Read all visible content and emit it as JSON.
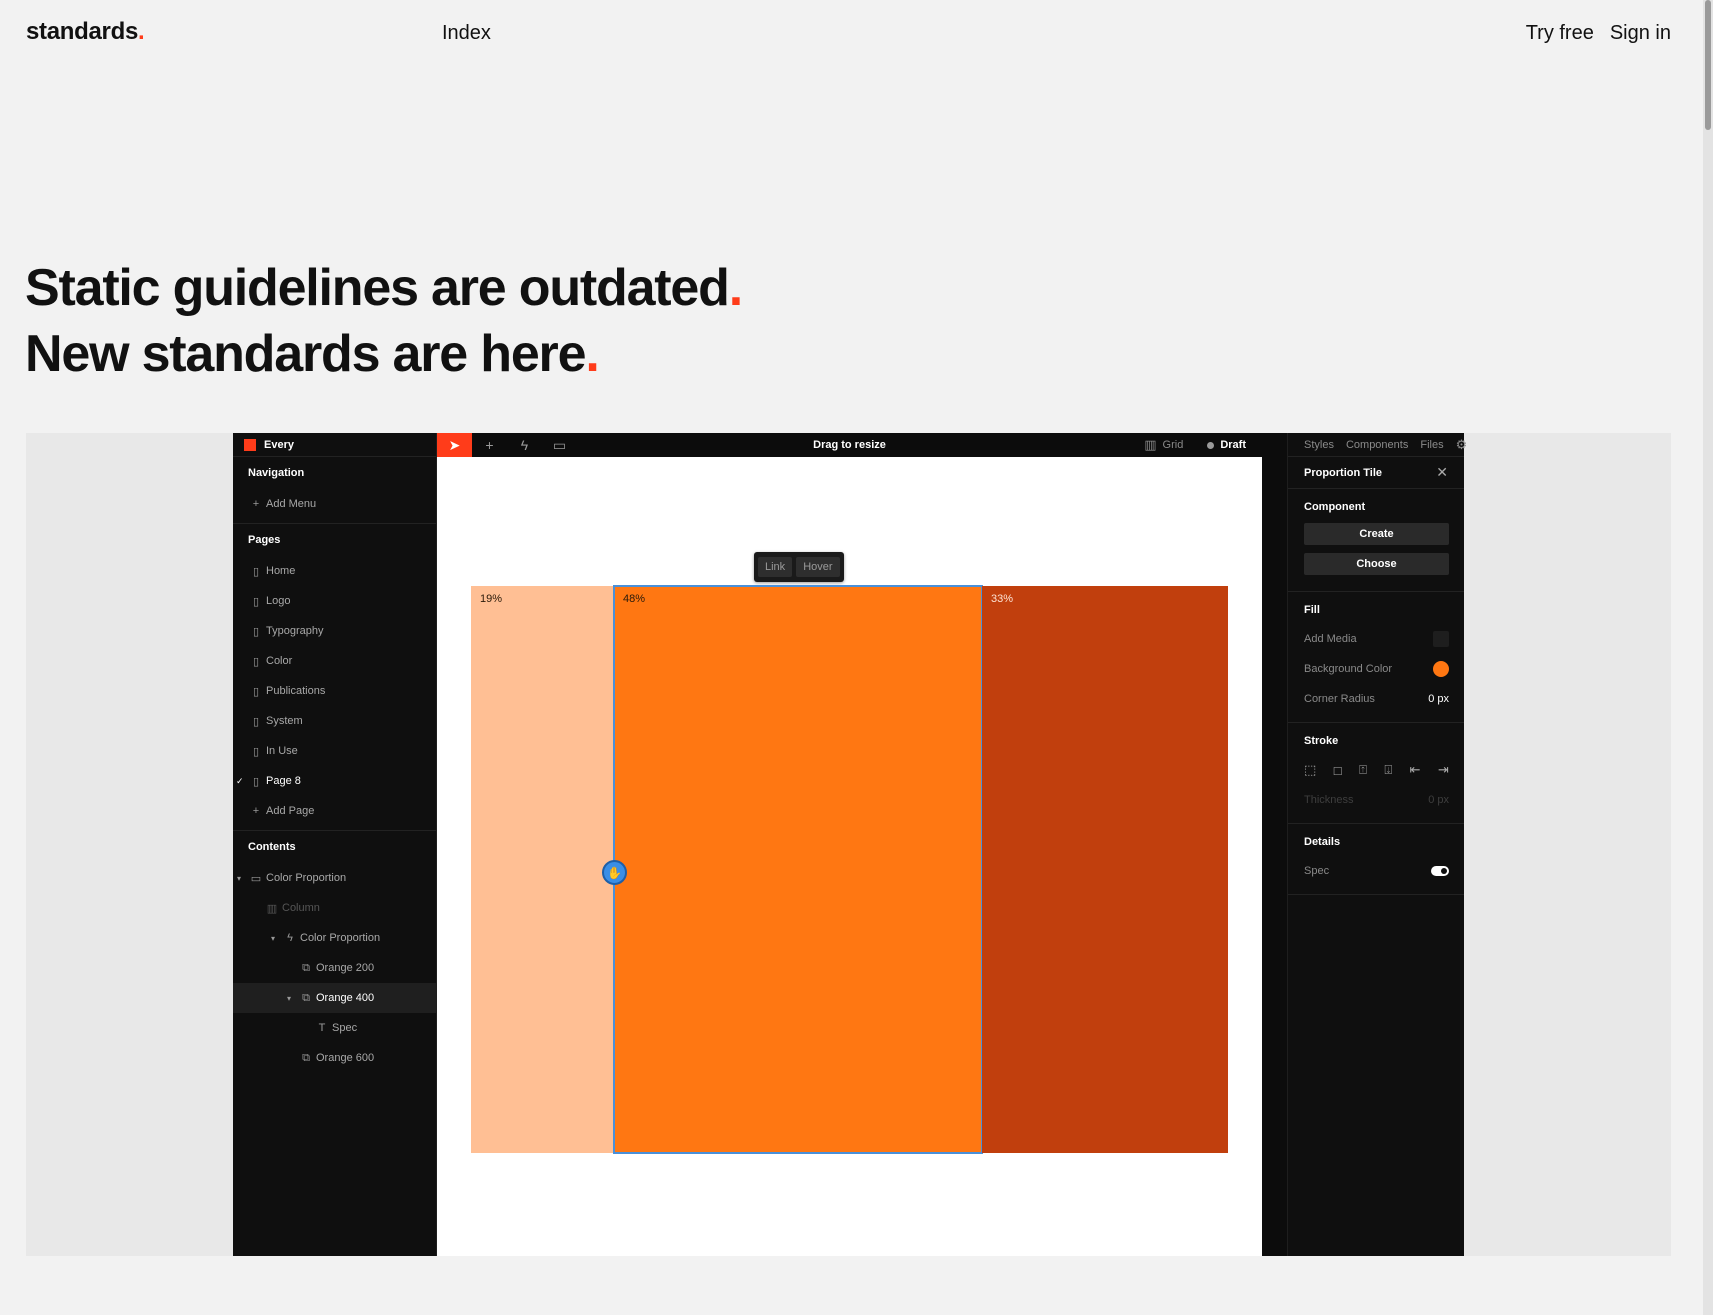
{
  "site": {
    "logo": "standards",
    "logo_dot": ".",
    "nav_index": "Index",
    "try_free": "Try free",
    "sign_in": "Sign in"
  },
  "hero": {
    "line1": "Static guidelines are outdated",
    "line2": "New standards are here",
    "dot": "."
  },
  "app": {
    "project_name": "Every",
    "toolbar": {
      "title": "Drag to resize",
      "grid_label": "Grid",
      "draft_label": "Draft"
    },
    "navigation": {
      "title": "Navigation",
      "add_menu": "Add Menu"
    },
    "pages": {
      "title": "Pages",
      "items": [
        "Home",
        "Logo",
        "Typography",
        "Color",
        "Publications",
        "System",
        "In Use",
        "Page 8"
      ],
      "add_page": "Add Page"
    },
    "contents": {
      "title": "Contents",
      "tree": [
        "Color Proportion",
        "Column",
        "Color Proportion",
        "Orange 200",
        "Orange 400",
        "Spec",
        "Orange 600"
      ]
    },
    "canvas": {
      "hover_pill": [
        "Link",
        "Hover"
      ],
      "tiles": [
        {
          "name": "Orange 200",
          "percent": "19%",
          "color": "#ffbf94"
        },
        {
          "name": "Orange 400",
          "percent": "48%",
          "color": "#ff7712"
        },
        {
          "name": "Orange 600",
          "percent": "33%",
          "color": "#c13f0d"
        }
      ]
    },
    "right_panel": {
      "tabs": [
        "Styles",
        "Components",
        "Files"
      ],
      "title": "Proportion Tile",
      "component": {
        "title": "Component",
        "create": "Create",
        "choose": "Choose"
      },
      "fill": {
        "title": "Fill",
        "add_media": "Add Media",
        "background_color": "Background Color",
        "background_color_value": "#ff7712",
        "corner_radius": "Corner Radius",
        "corner_radius_value": "0 px"
      },
      "stroke": {
        "title": "Stroke",
        "thickness": "Thickness",
        "thickness_value": "0 px"
      },
      "details": {
        "title": "Details",
        "spec": "Spec",
        "spec_on": true
      }
    }
  },
  "colors": {
    "accent": "#ff3c1a",
    "selection": "#4a90d9"
  }
}
